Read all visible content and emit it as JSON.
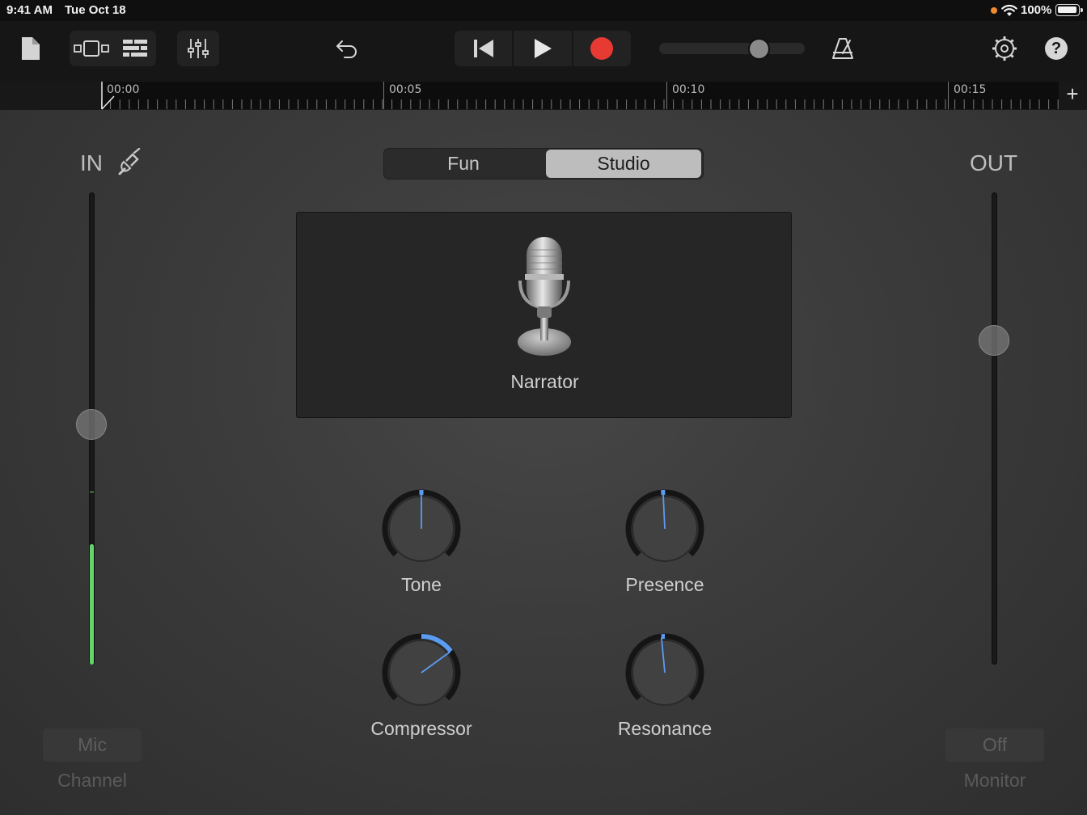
{
  "status_bar": {
    "time": "9:41 AM",
    "date": "Tue Oct 18",
    "battery": "100%",
    "recording_indicator_color": "#f08a30"
  },
  "toolbar": {
    "icons": [
      "document-icon",
      "tracks-view-icon",
      "mixer-icon",
      "undo-icon",
      "go-to-start-icon",
      "play-icon",
      "record-icon",
      "metronome-icon",
      "settings-icon",
      "help-icon"
    ],
    "record_color": "#e63a33",
    "help_label": "?",
    "master_volume": 0.72
  },
  "ruler": {
    "marks": [
      "00:00",
      "00:05",
      "00:10",
      "00:15"
    ],
    "add_label": "+"
  },
  "mode": {
    "options": [
      "Fun",
      "Studio"
    ],
    "selected": "Studio"
  },
  "preset": {
    "name": "Narrator",
    "icon": "vintage-microphone-icon"
  },
  "input": {
    "label": "IN",
    "icon": "input-jack-icon",
    "level": 0.51,
    "meter_level": 0.255,
    "meter_color": "#63d46a",
    "channel_value": "Mic",
    "channel_label": "Channel"
  },
  "output": {
    "label": "OUT",
    "level": 0.7,
    "monitor_value": "Off",
    "monitor_label": "Monitor"
  },
  "knobs": [
    {
      "label": "Tone",
      "value": 0.5
    },
    {
      "label": "Presence",
      "value": 0.49
    },
    {
      "label": "Compressor",
      "value": 0.7
    },
    {
      "label": "Resonance",
      "value": 0.48
    }
  ],
  "accent_color": "#5b9cf0"
}
